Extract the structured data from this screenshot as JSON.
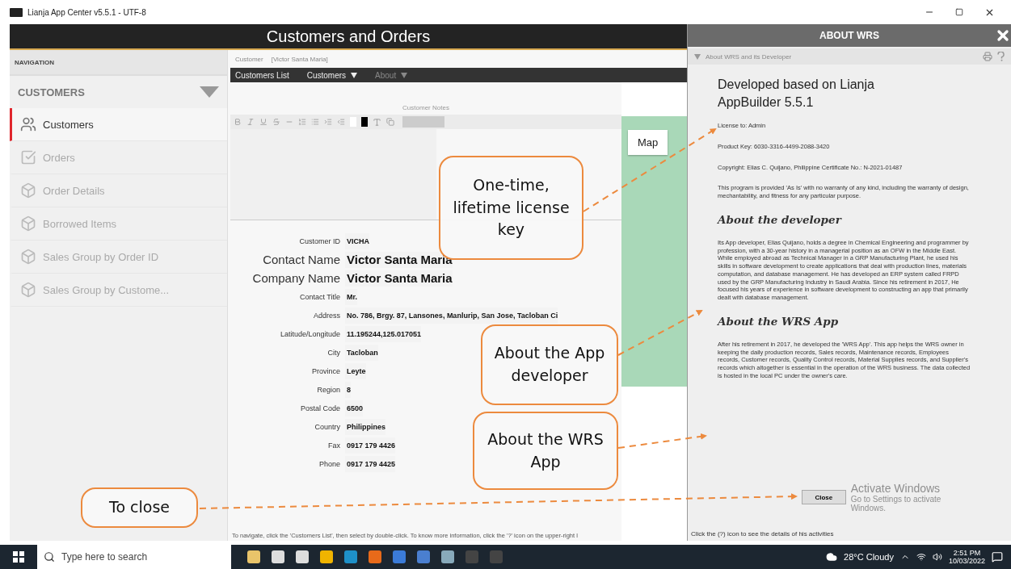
{
  "window": {
    "title": "Lianja App Center v5.5.1 - UTF-8"
  },
  "app_header": {
    "title": "Customers and Orders"
  },
  "navigation": {
    "heading": "NAVIGATION",
    "section": "CUSTOMERS",
    "items": [
      {
        "label": "Customers",
        "selected": true
      },
      {
        "label": "Orders",
        "selected": false
      },
      {
        "label": "Order Details",
        "selected": false
      },
      {
        "label": "Borrowed Items",
        "selected": false
      },
      {
        "label": "Sales Group by Order ID",
        "selected": false
      },
      {
        "label": "Sales Group by Custome...",
        "selected": false
      }
    ]
  },
  "breadcrumb": {
    "label": "Customer",
    "value": "[Victor Santa Maria]"
  },
  "menu": [
    {
      "label": "Customers List",
      "dropdown": false,
      "disabled": false
    },
    {
      "label": "Customers",
      "dropdown": true,
      "disabled": false
    },
    {
      "label": "About",
      "dropdown": true,
      "disabled": true
    }
  ],
  "notes": {
    "label": "Customer Notes"
  },
  "map": {
    "button": "Map"
  },
  "fields": [
    {
      "label": "Customer ID",
      "value": "VICHA",
      "kind": "normal"
    },
    {
      "label": "Contact Name",
      "value": "Victor Santa Maria",
      "kind": "large"
    },
    {
      "label": "Company Name",
      "value": "Victor Santa Maria",
      "kind": "large"
    },
    {
      "label": "Contact Title",
      "value": "Mr.",
      "kind": "normal"
    },
    {
      "label": "Address",
      "value": "No. 786, Brgy. 87, Lansones, Manlurip, San Jose, Tacloban Ci",
      "kind": "normal"
    },
    {
      "label": "Latitude/Longitude",
      "value": "11.195244,125.017051",
      "kind": "normal"
    },
    {
      "label": "City",
      "value": "Tacloban",
      "kind": "normal"
    },
    {
      "label": "Province",
      "value": "Leyte",
      "kind": "normal"
    },
    {
      "label": "Region",
      "value": "8",
      "kind": "normal"
    },
    {
      "label": "Postal Code",
      "value": "6500",
      "kind": "normal"
    },
    {
      "label": "Country",
      "value": "Philippines",
      "kind": "normal"
    },
    {
      "label": "Fax",
      "value": "0917 179  4426",
      "kind": "normal"
    },
    {
      "label": "Phone",
      "value": "0917 179  4425",
      "kind": "normal"
    }
  ],
  "hint": "To navigate, click the 'Customers List', then select by double-click. To know more information, click the '?' icon on the upper-right l",
  "about": {
    "title": "ABOUT WRS",
    "subtitle": "About WRS and its Developer",
    "heading": "Developed based on Lianja AppBuilder 5.5.1",
    "lines": [
      "License to: Admin",
      "Product Key: 6030-3316-4499-2088-3420",
      "Copyright: Elias C. Quijano, Philippine Certificate No.: N-2021-01487",
      "This program is provided 'As Is' with no warranty of any kind, including the warranty of design, mechantability, and fitness for any particular purpose."
    ],
    "sections": [
      {
        "title": "About the developer",
        "text": "Its App developer, Elias Quijano, holds a degree in Chemical Engineering and programmer by profession, with a 30-year history in a managerial position as an OFW in the Middle East. While employed abroad as Technical Manager in a GRP Manufacturing Plant, he used his skills in software development to create applications that deal with production lines, materials computation, and database management. He has developed an ERP system called FRPD used by the GRP Manufacturing Industry in Saudi Arabia. Since his retirement in 2017, He focused his years of experience in software development to constructing an app that primarily dealt with database management."
      },
      {
        "title": "About the WRS App",
        "text": "After his retirement in 2017, he developed the 'WRS App'. This app helps the WRS owner in keeping the daily production records, Sales records, Maintenance records, Employees records, Customer records, Quality Control records, Material Supplies records, and Supplier's records which altogether is essential in the operation of the WRS business. The data collected is hosted in the local PC under the owner's care."
      }
    ],
    "close_button": "Close",
    "footer": "Click the (?) icon to see the details of his activities"
  },
  "activation": {
    "title": "Activate Windows",
    "text": "Go to Settings to activate Windows."
  },
  "callouts": [
    {
      "text": "One-time, lifetime license key"
    },
    {
      "text": "About the App developer"
    },
    {
      "text": "About the WRS App"
    },
    {
      "text": "To close"
    }
  ],
  "taskbar": {
    "search_placeholder": "Type here to search",
    "weather": "28°C  Cloudy",
    "time": "2:51 PM",
    "date": "10/03/2022"
  }
}
